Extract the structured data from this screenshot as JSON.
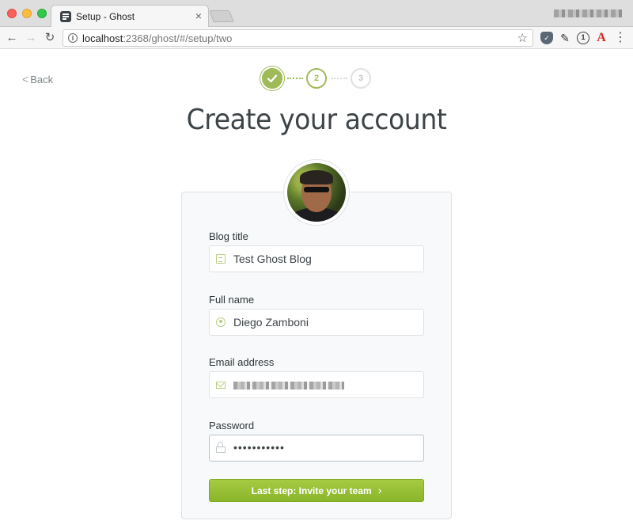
{
  "browser": {
    "tab_title": "Setup - Ghost",
    "tab_close": "×",
    "url_host": "localhost",
    "url_rest": ":2368/ghost/#/setup/two",
    "back_glyph": "←",
    "forward_glyph": "→",
    "reload_glyph": "↻",
    "star_glyph": "☆",
    "menu_glyph": "⋮",
    "acrobat_glyph": "A",
    "onepassword_glyph": "1"
  },
  "page": {
    "back_label": "Back",
    "back_chevron": "<",
    "heading": "Create your account",
    "steps": [
      {
        "label": "",
        "state": "done"
      },
      {
        "label": "2",
        "state": "active"
      },
      {
        "label": "3",
        "state": "todo"
      }
    ],
    "fields": {
      "blog_title": {
        "label": "Blog title",
        "value": "Test Ghost Blog",
        "icon": "book-icon"
      },
      "full_name": {
        "label": "Full name",
        "value": "Diego Zamboni",
        "icon": "user-icon"
      },
      "email": {
        "label": "Email address",
        "value": "",
        "icon": "mail-icon"
      },
      "password": {
        "label": "Password",
        "value": "•••••••••••",
        "icon": "lock-icon"
      }
    },
    "submit_label": "Last step: Invite your team",
    "submit_arrow": "›"
  },
  "colors": {
    "accent_green": "#9fbb58",
    "button_green": "#9ac23a",
    "heading_text": "#3d4447"
  }
}
